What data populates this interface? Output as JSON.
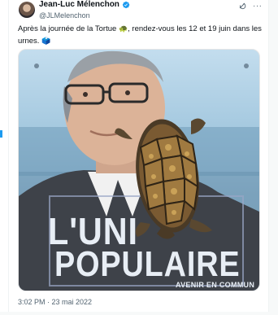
{
  "tweet": {
    "author": {
      "display_name": "Jean-Luc Mélenchon",
      "handle": "@JLMelenchon",
      "verified_icon": "verified-badge-icon",
      "avatar_icon": "avatar"
    },
    "actions": {
      "grok_icon": "grok-icon",
      "more_label": "···"
    },
    "text": {
      "line1_before": "Après la journée de la Tortue ",
      "turtle_emoji": "🐢",
      "line1_after": ", rendez-vous les 12 et 19 juin dans les urnes. ",
      "ballot_emoji": "🗳️"
    },
    "image": {
      "poster_line1": "L'UNI",
      "poster_line2": "POPULAIRE",
      "poster_tagline": "AVENIR EN COMMUN"
    },
    "meta": {
      "time": "3:02 PM",
      "separator": " · ",
      "date": "23 mai 2022"
    }
  },
  "colors": {
    "text": "#0f1419",
    "secondary": "#536471",
    "accent": "#1d9bf0"
  }
}
